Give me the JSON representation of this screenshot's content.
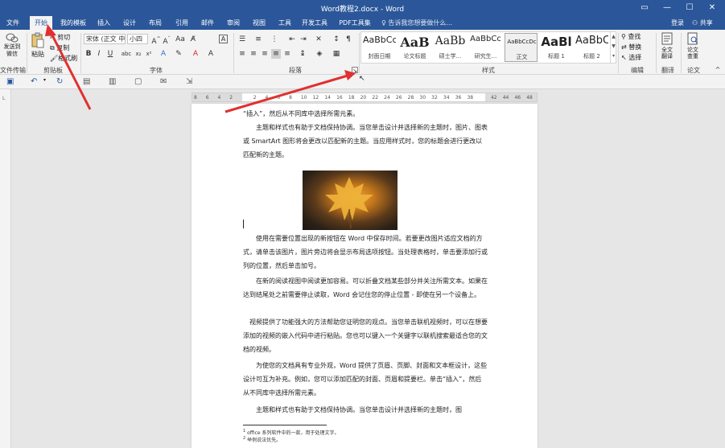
{
  "window": {
    "title": "Word教程2.docx - Word",
    "controls": [
      "ribbon-display",
      "minimize",
      "maximize",
      "close"
    ]
  },
  "tabs": [
    {
      "label": "文件"
    },
    {
      "label": "开始"
    },
    {
      "label": "我的模板"
    },
    {
      "label": "插入"
    },
    {
      "label": "设计"
    },
    {
      "label": "布局"
    },
    {
      "label": "引用"
    },
    {
      "label": "邮件"
    },
    {
      "label": "审阅"
    },
    {
      "label": "视图"
    },
    {
      "label": "工具"
    },
    {
      "label": "开发工具"
    },
    {
      "label": "PDF工具集"
    }
  ],
  "active_tab": "开始",
  "tell_me": "告诉我您想要做什么...",
  "login_label": "登录",
  "share_label": "共享",
  "ribbon": {
    "file_transfer": {
      "button": "发送到微信",
      "group": "文件传输"
    },
    "clipboard": {
      "paste": "粘贴",
      "cut": "剪切",
      "copy": "复制",
      "format_painter": "格式刷",
      "group": "剪贴板"
    },
    "font": {
      "font_name": "宋体 (正文 中",
      "font_size": "小四",
      "group": "字体"
    },
    "paragraph": {
      "group": "段落"
    },
    "styles": {
      "group": "样式",
      "items": [
        {
          "preview": "AaBbCc",
          "label": "封面日期"
        },
        {
          "preview": "AaB",
          "label": "论文标题"
        },
        {
          "preview": "AaBb",
          "label": "硕士学..."
        },
        {
          "preview": "AaBbCc",
          "label": "研究生..."
        },
        {
          "preview": "AaBbCcDc",
          "label": "正文"
        },
        {
          "preview": "AaBl",
          "label": "标题 1"
        },
        {
          "preview": "AaBbC",
          "label": "标题 2"
        }
      ]
    },
    "editing": {
      "find": "查找",
      "replace": "替换",
      "select": "选择",
      "group": "编辑"
    },
    "translate": {
      "button": "全文翻译",
      "group": "翻译"
    },
    "thesis": {
      "button": "论文查重",
      "group": "论文"
    }
  },
  "ruler": {
    "ticks": [
      "8",
      "6",
      "4",
      "2",
      "",
      "2",
      "4",
      "6",
      "8",
      "10",
      "12",
      "14",
      "16",
      "18",
      "20",
      "22",
      "24",
      "26",
      "28",
      "30",
      "32",
      "34",
      "36",
      "38",
      "",
      "42",
      "44",
      "46",
      "48"
    ]
  },
  "document": {
    "paragraphs": [
      "“插入”，然后从不同库中选择所需元素。",
      "主题和样式也有助于文档保持协调。当您单击设计并选择新的主题时，图片、图表或 SmartArt 图形将会更改以匹配新的主题。当应用样式时，您的标题会进行更改以匹配新的主题。",
      "使用在需要位置出现的新按钮在 Word 中保存时间。若要更改图片适应文档的方式，请单击该图片，图片旁边将会显示布局选项按钮。当处理表格时，单击要添加行或列的位置，然后单击加号。",
      "在新的阅读视图中阅读更加容易。可以折叠文档某些部分并关注所需文本。如果在达到结尾处之前需要停止读取，Word 会记住您的停止位置 - 即使在另一个设备上。",
      "视频提供了功能强大的方法帮助您证明您的观点。当您单击联机视频时，可以在想要添加的视频的嵌入代码中进行粘贴。您也可以键入一个关键字以联机搜索最适合您的文档的视频。",
      "为使您的文档具有专业外观，Word 提供了页眉、页脚、封面和文本框设计，这些设计可互为补充。例如，您可以添加匹配的封面、页眉和提要栏。单击“插入”，然后从不同库中选择所需元素。",
      "主题和样式也有助于文档保持协调。当您单击设计并选择新的主题时，图"
    ],
    "footnotes": [
      "office 系列软件中的一款，用于处理文字。",
      "举例说法优先。"
    ]
  },
  "colors": {
    "brand_blue": "#2b579a",
    "ribbon_bg": "#f3f3f3",
    "arrow_red": "#e03030"
  }
}
